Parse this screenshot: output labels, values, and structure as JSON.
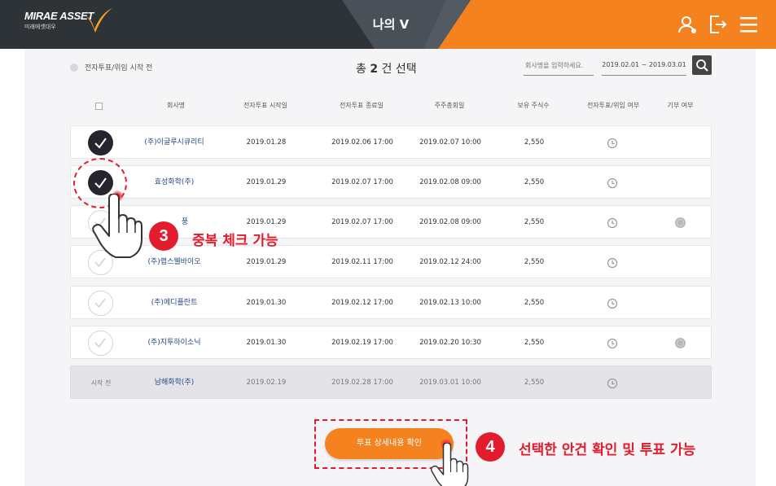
{
  "header": {
    "logo_text": "MIRAE ASSET",
    "logo_subtext": "미래에셋대우",
    "title": "나의 V"
  },
  "filter": {
    "status_label": "전자투표/위임 시작 전",
    "total_prefix": "총",
    "total_count": "2",
    "total_suffix": "건 선택",
    "search_placeholder": "회사명을 입력하세요.",
    "date_range": "2019.02.01 ~ 2019.03.01"
  },
  "columns": [
    "회사명",
    "전자투표 시작일",
    "전자투표 종료일",
    "주주총회일",
    "보유 주식수",
    "전자투표/위임 여부",
    "기부 여부"
  ],
  "rows": [
    {
      "company": "(주)이글루시큐리티",
      "start": "2019.01.28",
      "end": "2019.02.06 17:00",
      "meeting": "2019.02.07 10:00",
      "shares": "2,550",
      "check": "checked",
      "donation": false
    },
    {
      "company": "효성화학(주)",
      "start": "2019.01.29",
      "end": "2019.02.07 17:00",
      "meeting": "2019.02.08 09:00",
      "shares": "2,550",
      "check": "checked",
      "donation": false
    },
    {
      "company": "풍",
      "start": "2019.01.29",
      "end": "2019.02.07 17:00",
      "meeting": "2019.02.08 09:00",
      "shares": "2,550",
      "check": "unchecked",
      "donation": true
    },
    {
      "company": "(주)랩스웰바이오",
      "start": "2019.01.29",
      "end": "2019.02.11 17:00",
      "meeting": "2019.02.12 24:00",
      "shares": "2,550",
      "check": "unchecked",
      "donation": false
    },
    {
      "company": "(주)메디플란트",
      "start": "2019.01.30",
      "end": "2019.02.12 17:00",
      "meeting": "2019.02.13 10:00",
      "shares": "2,550",
      "check": "unchecked",
      "donation": false
    },
    {
      "company": "(주)지투하이소닉",
      "start": "2019.01.30",
      "end": "2019.02.19 17:00",
      "meeting": "2019.02.20 10:30",
      "shares": "2,550",
      "check": "unchecked",
      "donation": true
    },
    {
      "status": "시작 전",
      "company": "남해화학(주)",
      "start": "2019.02.19",
      "end": "2019.02.28 17:00",
      "meeting": "2019.03.01 10:00",
      "shares": "2,550",
      "check": "inactive",
      "donation": false
    }
  ],
  "confirm_button": "투표 상세내용 확인",
  "annotations": {
    "step3_number": "3",
    "step3_text": "중복 체크 가능",
    "step4_number": "4",
    "step4_text": "선택한 안건 확인 및 투표 가능"
  },
  "icons": {
    "logo_mark": "v-check-logo-icon",
    "user": "user-icon",
    "logout": "logout-icon",
    "menu": "hamburger-menu-icon",
    "search": "search-icon",
    "vote_status": "clock-icon",
    "donation": "coin-icon",
    "pointer": "hand-pointer-icon"
  },
  "colors": {
    "header_dark": "#2e3338",
    "header_orange": "#f4821f",
    "accent_red": "#e31c2d",
    "company_link": "#234a86",
    "check_on": "#25252d"
  }
}
